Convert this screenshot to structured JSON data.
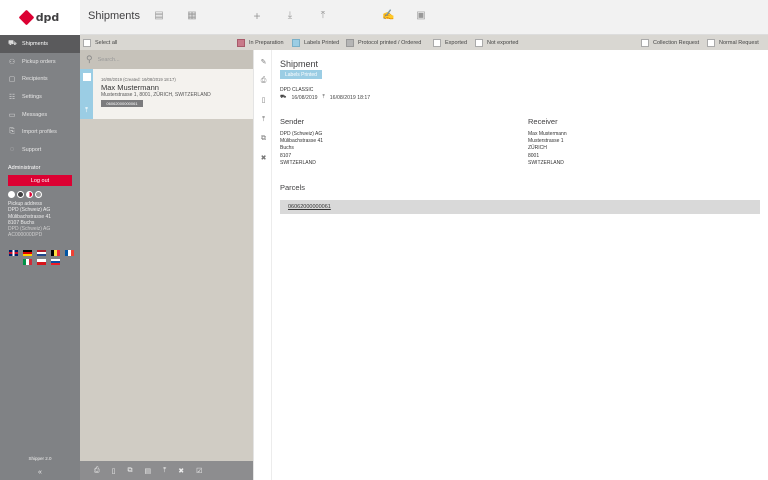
{
  "brand": {
    "name": "dpd"
  },
  "header": {
    "title": "Shipments",
    "actions": [
      "view-list-icon",
      "grid-icon",
      "plus-icon",
      "download-icon",
      "upload-icon",
      "signature-icon",
      "calendar-clock-icon"
    ]
  },
  "sidebar": {
    "items": [
      {
        "label": "Shipments",
        "icon": "truck-icon"
      },
      {
        "label": "Pickup orders",
        "icon": "pickup-icon"
      },
      {
        "label": "Recipients",
        "icon": "contact-card-icon"
      },
      {
        "label": "Settings",
        "icon": "settings-icon"
      },
      {
        "label": "Messages",
        "icon": "message-icon"
      },
      {
        "label": "Import profiles",
        "icon": "import-icon"
      },
      {
        "label": "Support",
        "icon": "support-icon"
      }
    ],
    "role": "Administrator",
    "logout_label": "Log out",
    "pickup": {
      "title": "Pickup address",
      "line1": "DPD (Schweiz) AG",
      "line2": "Mülibachstrasse 41",
      "line3": "8107 Buchs",
      "line4": "DPD (Schweiz) AG",
      "line5": "AC000000DPD"
    },
    "version": "Shipper 2.0",
    "collapse": "«"
  },
  "filters": {
    "select_all": "Select all",
    "in_preparation": "In Preparation",
    "labels_printed": "Labels Printed",
    "protocol_printed": "Protocol printed / Ordered",
    "exported": "Exported",
    "not_exported": "Not exported",
    "collection_request": "Collection Request",
    "normal_request": "Normal Request",
    "colors": {
      "in_preparation": "#c87a8a",
      "labels_printed": "#9bcde4",
      "protocol_printed": "#b5b5b5"
    }
  },
  "search": {
    "placeholder": "Search..."
  },
  "list": [
    {
      "meta": "16/08/2019 (Created: 16/08/2019 18:17)",
      "name": "Max Mustermann",
      "address": "Musterstrasse 1, 8001, ZÜRICH, SWITZERLAND",
      "parcel": "06062000000061"
    }
  ],
  "detail": {
    "title": "Shipment",
    "status": "Labels Printed",
    "service": "DPD CLASSIC",
    "shipment_date": "16/08/2019",
    "created": "16/08/2019 18:17",
    "sender": {
      "heading": "Sender",
      "name": "DPD (Schweiz) AG",
      "street": "Mülibachstrasse 41",
      "city": "Buchs",
      "zip": "8107",
      "country": "SWITZERLAND"
    },
    "receiver": {
      "heading": "Receiver",
      "name": "Max Mustermann",
      "street": "Musterstrasse 1",
      "city": "ZÜRICH",
      "zip": "8001",
      "country": "SWITZERLAND"
    },
    "parcels_heading": "Parcels",
    "parcels": [
      "06062000000061"
    ]
  },
  "colors": {
    "brand_red": "#dc0032",
    "sidebar": "#808285",
    "accent_blue": "#9bcde4"
  }
}
